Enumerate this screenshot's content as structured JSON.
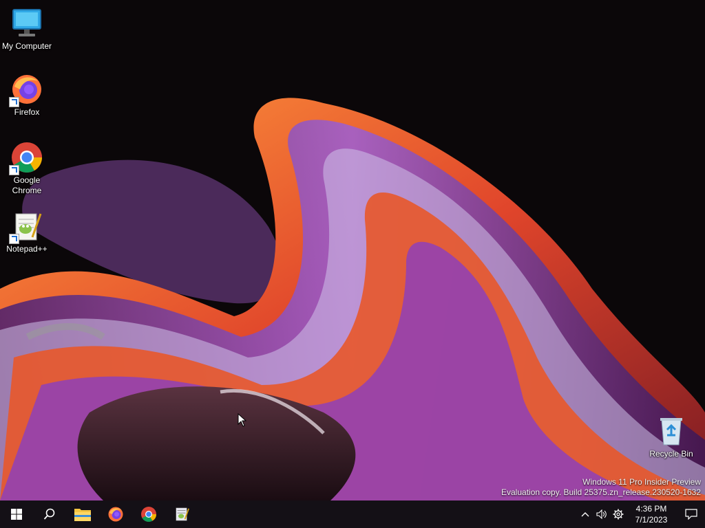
{
  "desktop": {
    "icons": [
      {
        "label": "My Computer",
        "icon": "computer-icon"
      },
      {
        "label": "Firefox",
        "icon": "firefox-icon"
      },
      {
        "label": "Google Chrome",
        "icon": "chrome-icon"
      },
      {
        "label": "Notepad++",
        "icon": "notepadpp-icon"
      },
      {
        "label": "Recycle Bin",
        "icon": "recycle-bin-icon"
      }
    ],
    "watermark": {
      "line1": "Windows 11 Pro Insider Preview",
      "line2": "Evaluation copy. Build 25375.zn_release.230520-1632"
    }
  },
  "taskbar": {
    "items": [
      "start-icon",
      "search-icon",
      "file-explorer-icon",
      "firefox-icon",
      "chrome-icon",
      "notepadpp-icon"
    ],
    "tray": {
      "icons": [
        "chevron-up-icon",
        "volume-icon",
        "settings-icon"
      ],
      "time": "4:36 PM",
      "date": "7/1/2023",
      "notification_icon": "notification-icon"
    }
  },
  "colors": {
    "taskbar_bg": "#141016",
    "wallpaper_base": "#0b0709",
    "accent_orange": "#e8582a",
    "accent_purple": "#6a2c9a"
  }
}
